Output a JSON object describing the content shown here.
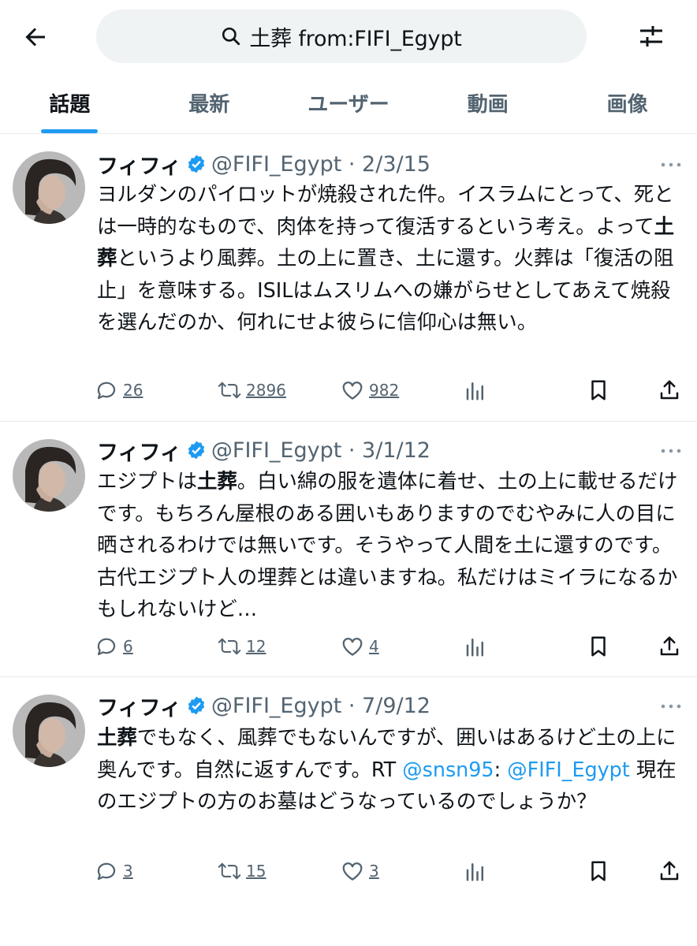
{
  "search": {
    "query": "土葬 from:FIFI_Egypt"
  },
  "tabs": [
    {
      "label": "話題",
      "active": true
    },
    {
      "label": "最新",
      "active": false
    },
    {
      "label": "ユーザー",
      "active": false
    },
    {
      "label": "動画",
      "active": false
    },
    {
      "label": "画像",
      "active": false
    }
  ],
  "colors": {
    "accent": "#1d9bf0",
    "muted": "#536471",
    "text": "#0f1419"
  },
  "tweets": [
    {
      "name": "フィフィ",
      "handle_date": "@FIFI_Egypt · 2/3/15",
      "text_parts": [
        {
          "t": "ヨルダンのパイロットが焼殺された件。イスラムにとって、死とは一時的なもので、肉体を持って復活するという考え。よって",
          "b": false
        },
        {
          "t": "土葬",
          "b": true
        },
        {
          "t": "というより風葬。土の上に置き、土に還す。火葬は「復活の阻止」を意味する。ISILはムスリムへの嫌がらせとしてあえて焼殺を選んだのか、何れにせよ彼らに信仰心は無い。",
          "b": false
        }
      ],
      "replies": "26",
      "retweets": "2896",
      "likes": "982"
    },
    {
      "name": "フィフィ",
      "handle_date": "@FIFI_Egypt · 3/1/12",
      "text_parts": [
        {
          "t": "エジプトは",
          "b": false
        },
        {
          "t": "土葬",
          "b": true
        },
        {
          "t": "。白い綿の服を遺体に着せ、土の上に載せるだけです。もちろん屋根のある囲いもありますのでむやみに人の目に晒されるわけでは無いです。そうやって人間を土に還すのです。古代エジプト人の埋葬とは違いますね。私だけはミイラになるかもしれないけど…",
          "b": false
        }
      ],
      "replies": "6",
      "retweets": "12",
      "likes": "4"
    },
    {
      "name": "フィフィ",
      "handle_date": "@FIFI_Egypt · 7/9/12",
      "text_parts": [
        {
          "t": "土葬",
          "b": true
        },
        {
          "t": "でもなく、風葬でもないんですが、囲いはあるけど土の上に奥んです。自然に返すんです。RT ",
          "b": false
        },
        {
          "t": "@snsn95",
          "b": false,
          "link": true
        },
        {
          "t": ": ",
          "b": false
        },
        {
          "t": "@FIFI_Egypt",
          "b": false,
          "link": true
        },
        {
          "t": " 現在のエジプトの方のお墓はどうなっているのでしょうか？",
          "b": false
        }
      ],
      "replies": "3",
      "retweets": "15",
      "likes": "3"
    }
  ]
}
